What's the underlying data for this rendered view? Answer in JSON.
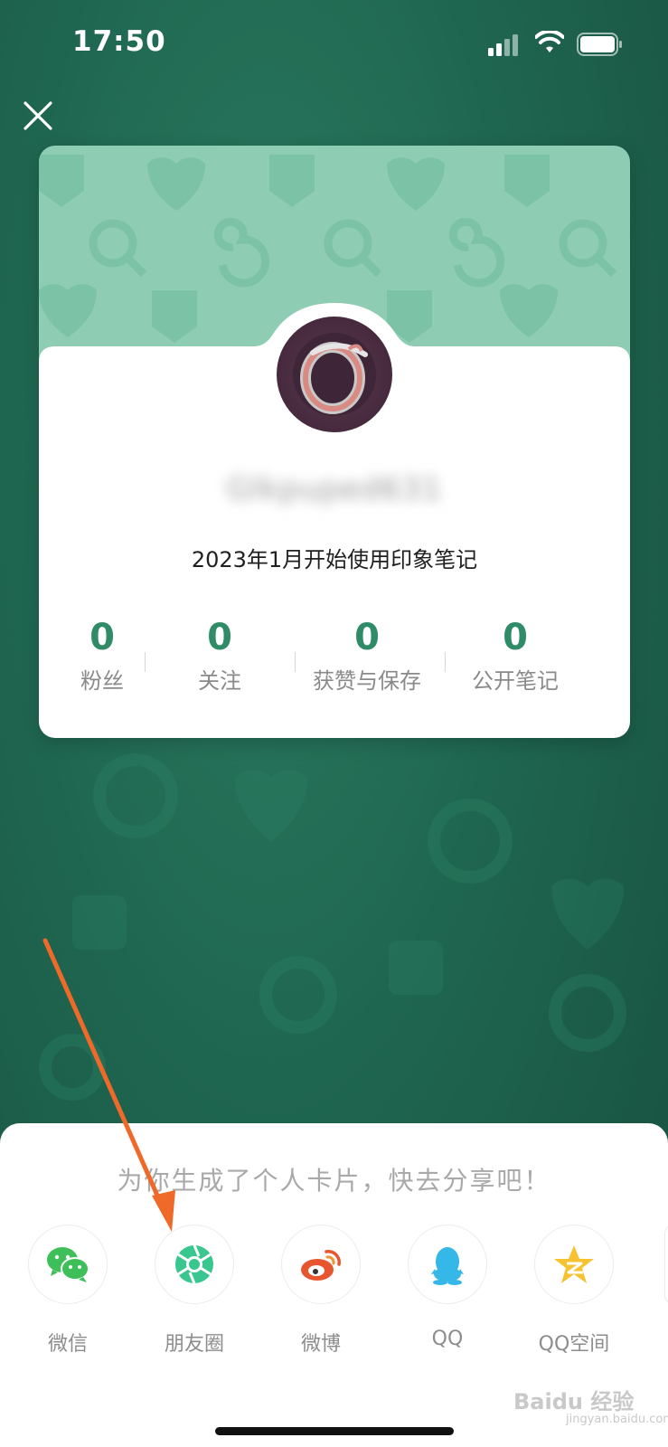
{
  "status_bar": {
    "time": "17:50"
  },
  "card": {
    "username": "Glkpuped631",
    "since_text": "2023年1月开始使用印象笔记",
    "stats": [
      {
        "value": "0",
        "label": "粉丝"
      },
      {
        "value": "0",
        "label": "关注"
      },
      {
        "value": "0",
        "label": "获赞与保存"
      },
      {
        "value": "0",
        "label": "公开笔记"
      }
    ]
  },
  "share_sheet": {
    "title": "为你生成了个人卡片，快去分享吧！",
    "targets": [
      {
        "label": "微信",
        "icon": "wechat-icon"
      },
      {
        "label": "朋友圈",
        "icon": "moments-icon"
      },
      {
        "label": "微博",
        "icon": "weibo-icon"
      },
      {
        "label": "QQ",
        "icon": "qq-icon"
      },
      {
        "label": "QQ空间",
        "icon": "qzone-icon"
      }
    ]
  },
  "watermark": {
    "main": "Baidu 经验",
    "sub": "jingyan.baidu.com"
  },
  "colors": {
    "accent_green": "#2f8c67",
    "card_header": "#8ecdb4",
    "annotation_arrow": "#ef6a28"
  }
}
